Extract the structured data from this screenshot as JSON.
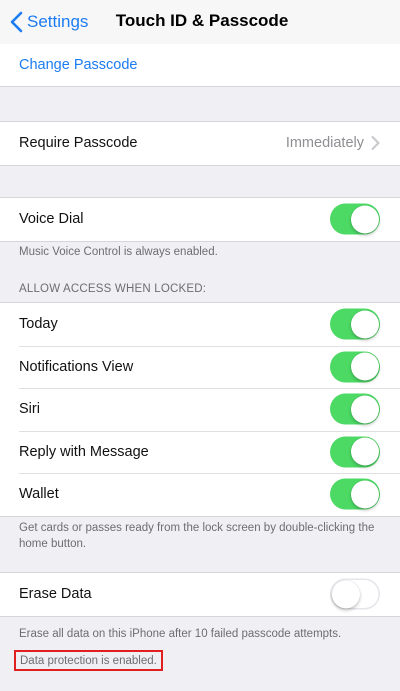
{
  "navbar": {
    "back_label": "Settings",
    "title": "Touch ID & Passcode"
  },
  "passcode_group": {
    "change_passcode": "Change Passcode"
  },
  "require_group": {
    "label": "Require Passcode",
    "value": "Immediately"
  },
  "voice_group": {
    "label": "Voice Dial",
    "state": "on",
    "footer": "Music Voice Control is always enabled."
  },
  "locked_section": {
    "header": "ALLOW ACCESS WHEN LOCKED:",
    "items": [
      {
        "label": "Today",
        "state": "on"
      },
      {
        "label": "Notifications View",
        "state": "on"
      },
      {
        "label": "Siri",
        "state": "on"
      },
      {
        "label": "Reply with Message",
        "state": "on"
      },
      {
        "label": "Wallet",
        "state": "on"
      }
    ],
    "footer": "Get cards or passes ready from the lock screen by double-clicking the home button."
  },
  "erase_group": {
    "label": "Erase Data",
    "state": "off",
    "footer": "Erase all data on this iPhone after 10 failed passcode attempts.",
    "status": "Data protection is enabled."
  },
  "colors": {
    "accent": "#1c7cf3",
    "toggle_on": "#4cd964",
    "highlight_border": "#e02020",
    "background": "#efeff4"
  },
  "icons": {
    "back": "chevron-left-icon",
    "disclosure": "chevron-right-icon"
  }
}
